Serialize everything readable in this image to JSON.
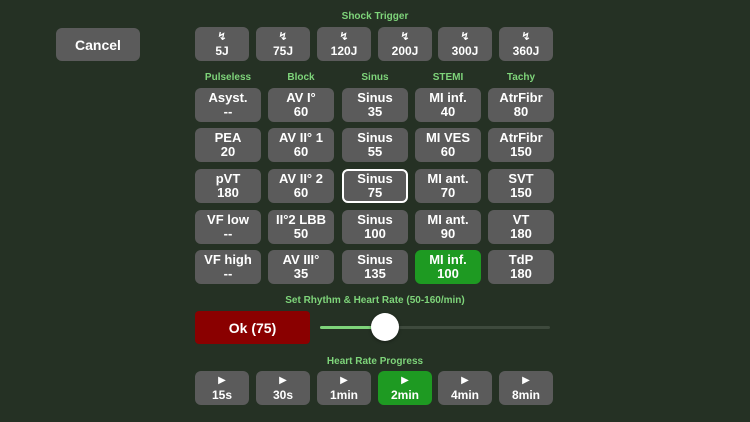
{
  "cancel_label": "Cancel",
  "shock": {
    "title": "Shock Trigger",
    "glyph": "↯",
    "items": [
      "5J",
      "75J",
      "120J",
      "200J",
      "300J",
      "360J"
    ]
  },
  "columns": [
    "Pulseless",
    "Block",
    "Sinus",
    "STEMI",
    "Tachy"
  ],
  "grid": [
    [
      {
        "line1": "Asyst.",
        "line2": "--"
      },
      {
        "line1": "PEA",
        "line2": "20"
      },
      {
        "line1": "pVT",
        "line2": "180"
      },
      {
        "line1": "VF low",
        "line2": "--"
      },
      {
        "line1": "VF high",
        "line2": "--"
      }
    ],
    [
      {
        "line1": "AV I°",
        "line2": "60"
      },
      {
        "line1": "AV II° 1",
        "line2": "60"
      },
      {
        "line1": "AV II° 2",
        "line2": "60"
      },
      {
        "line1": "II°2 LBB",
        "line2": "50"
      },
      {
        "line1": "AV III°",
        "line2": "35"
      }
    ],
    [
      {
        "line1": "Sinus",
        "line2": "35"
      },
      {
        "line1": "Sinus",
        "line2": "55"
      },
      {
        "line1": "Sinus",
        "line2": "75",
        "state": "selected"
      },
      {
        "line1": "Sinus",
        "line2": "100"
      },
      {
        "line1": "Sinus",
        "line2": "135"
      }
    ],
    [
      {
        "line1": "MI inf.",
        "line2": "40"
      },
      {
        "line1": "MI VES",
        "line2": "60"
      },
      {
        "line1": "MI ant.",
        "line2": "70"
      },
      {
        "line1": "MI ant.",
        "line2": "90"
      },
      {
        "line1": "MI inf.",
        "line2": "100",
        "state": "active"
      }
    ],
    [
      {
        "line1": "AtrFibr",
        "line2": "80"
      },
      {
        "line1": "AtrFibr",
        "line2": "150"
      },
      {
        "line1": "SVT",
        "line2": "150"
      },
      {
        "line1": "VT",
        "line2": "180"
      },
      {
        "line1": "TdP",
        "line2": "180"
      }
    ]
  ],
  "rhythm": {
    "title": "Set Rhythm & Heart Rate (50-160/min)",
    "ok_label": "Ok (75)",
    "slider_value": 75,
    "slider_min": 50,
    "slider_max": 160
  },
  "progress": {
    "title": "Heart Rate Progress",
    "glyph": "▶",
    "items": [
      "15s",
      "30s",
      "1min",
      "2min",
      "4min",
      "8min"
    ],
    "active_index": 3
  },
  "colors": {
    "background": "#253124",
    "button": "#5b5b5b",
    "active": "#1e9a22",
    "ok": "#8a0000",
    "label": "#7ed47a"
  }
}
